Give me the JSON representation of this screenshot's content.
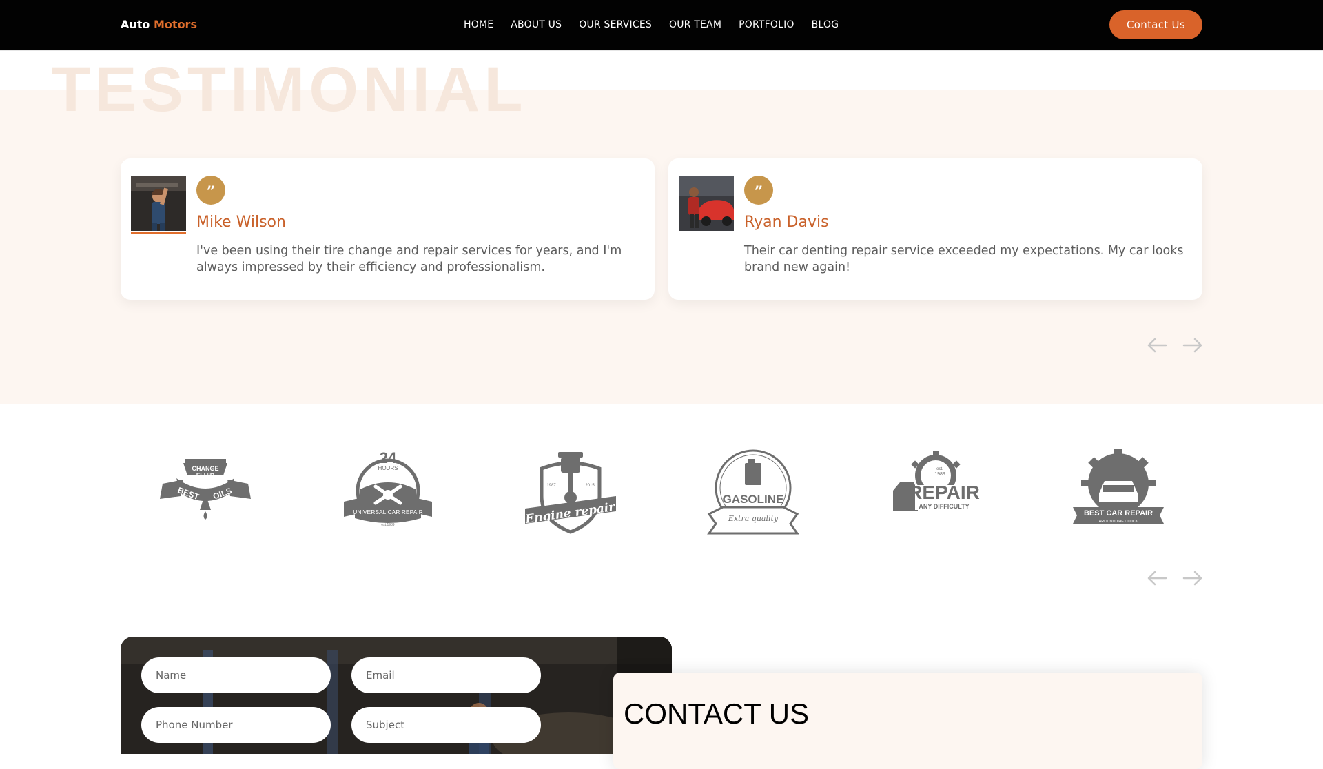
{
  "nav": {
    "brand_first": "Auto",
    "brand_second": "Motors",
    "items": [
      "HOME",
      "ABOUT US",
      "OUR SERVICES",
      "OUR TEAM",
      "PORTFOLIO",
      "BLOG"
    ],
    "cta": "Contact Us"
  },
  "testimonial": {
    "watermark": "TESTIMONIAL",
    "cards": [
      {
        "name": "Mike Wilson",
        "text": "I've been using their tire change and repair services for years, and I'm always impressed by their efficiency and professionalism."
      },
      {
        "name": "Ryan Davis",
        "text": "Their car denting repair service exceeded my expectations. My car looks brand new again!"
      }
    ]
  },
  "logos": [
    {
      "icon": "best-oils-logo",
      "lines": [
        "CHANGE",
        "FLUID",
        "BEST",
        "OILS"
      ]
    },
    {
      "icon": "24-hours-repair-logo",
      "lines": [
        "24",
        "HOURS",
        "UNIVERSAL CAR REPAIR",
        "est.1989"
      ]
    },
    {
      "icon": "engine-repair-logo",
      "lines": [
        "1987",
        "2015",
        "Engine repair"
      ]
    },
    {
      "icon": "gasoline-logo",
      "lines": [
        "GASOLINE",
        "Extra quality"
      ]
    },
    {
      "icon": "repair-any-difficulty-logo",
      "lines": [
        "est.",
        "1989",
        "REPAIR",
        "ANY DIFFICULTY"
      ]
    },
    {
      "icon": "best-car-repair-logo",
      "lines": [
        "BEST CAR REPAIR",
        "AROUND THE CLOCK"
      ]
    }
  ],
  "contact": {
    "title": "CONTACT US",
    "name_placeholder": "Name",
    "email_placeholder": "Email",
    "phone_placeholder": "Phone Number",
    "subject_placeholder": "Subject"
  },
  "colors": {
    "accent": "#d9632a",
    "quote_badge": "#c7964b",
    "section_bg": "#fdf6f1"
  }
}
